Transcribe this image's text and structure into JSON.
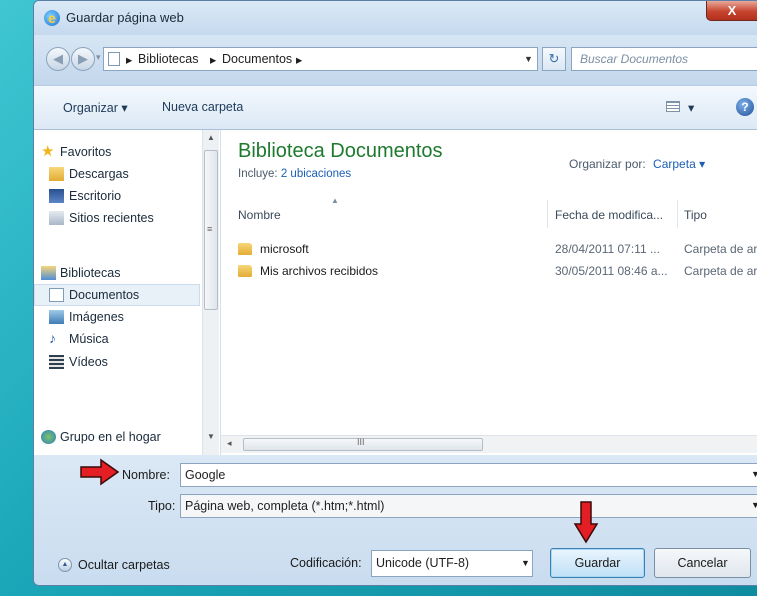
{
  "window": {
    "title": "Guardar página web",
    "close_label": "X"
  },
  "nav": {
    "breadcrumb": [
      "Bibliotecas",
      "Documentos"
    ],
    "search_placeholder": "Buscar Documentos"
  },
  "toolbar": {
    "organize": "Organizar ▾",
    "new_folder": "Nueva carpeta",
    "views": "▾",
    "help": "?"
  },
  "sidebar": {
    "items": [
      {
        "label": "Favoritos",
        "icon": "star-icon"
      },
      {
        "label": "Descargas",
        "icon": "download-folder-icon"
      },
      {
        "label": "Escritorio",
        "icon": "desktop-icon"
      },
      {
        "label": "Sitios recientes",
        "icon": "recent-places-icon"
      },
      {
        "label": "Bibliotecas",
        "icon": "libraries-icon"
      },
      {
        "label": "Documentos",
        "icon": "documents-icon"
      },
      {
        "label": "Imágenes",
        "icon": "pictures-icon"
      },
      {
        "label": "Música",
        "icon": "music-icon"
      },
      {
        "label": "Vídeos",
        "icon": "videos-icon"
      },
      {
        "label": "Grupo en el hogar",
        "icon": "homegroup-icon"
      }
    ]
  },
  "library": {
    "title": "Biblioteca Documentos",
    "includes_prefix": "Incluye:",
    "includes_link": "2 ubicaciones",
    "organize_by_label": "Organizar por:",
    "organize_by_value": "Carpeta ▾"
  },
  "table": {
    "columns": [
      "Nombre",
      "Fecha de modifica...",
      "Tipo"
    ],
    "rows": [
      {
        "name": "microsoft",
        "date": "28/04/2011 07:11 ...",
        "type": "Carpeta de archivos"
      },
      {
        "name": "Mis archivos recibidos",
        "date": "30/05/2011 08:46 a...",
        "type": "Carpeta de archivos"
      }
    ]
  },
  "form": {
    "name_label": "Nombre:",
    "name_value": "Google",
    "type_label": "Tipo:",
    "type_value": "Página web, completa (*.htm;*.html)",
    "hide_folders": "Ocultar carpetas",
    "encoding_label": "Codificación:",
    "encoding_value": "Unicode (UTF-8)",
    "save": "Guardar",
    "cancel": "Cancelar"
  },
  "colors": {
    "accent_green": "#1d7a2f",
    "arrow_red": "#e31e24"
  }
}
